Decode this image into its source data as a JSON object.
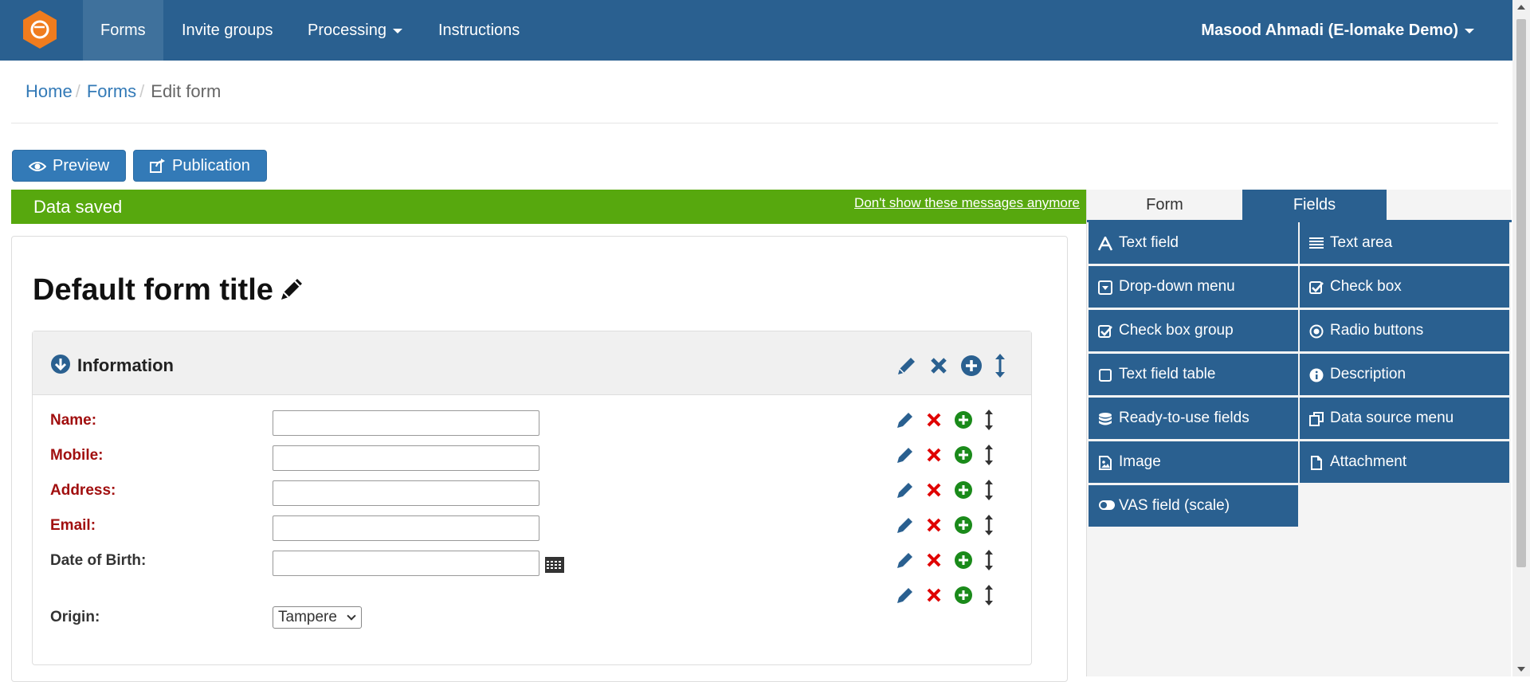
{
  "navbar": {
    "items": [
      {
        "label": "Forms",
        "active": true
      },
      {
        "label": "Invite groups",
        "active": false
      },
      {
        "label": "Processing",
        "active": false,
        "dropdown": true
      },
      {
        "label": "Instructions",
        "active": false
      }
    ],
    "user": "Masood Ahmadi (E-lomake Demo)",
    "logo_color": "#f07c1e"
  },
  "breadcrumb": {
    "home": "Home",
    "forms": "Forms",
    "current": "Edit form"
  },
  "actions": {
    "preview": "Preview",
    "publication": "Publication"
  },
  "alert": {
    "text": "Data saved",
    "dismiss": "Don't show these messages anymore",
    "color": "#57a80e"
  },
  "form": {
    "title": "Default form title",
    "section": {
      "title": "Information",
      "fields": [
        {
          "label": "Name:",
          "required": true,
          "type": "text",
          "value": ""
        },
        {
          "label": "Mobile:",
          "required": true,
          "type": "text",
          "value": ""
        },
        {
          "label": "Address:",
          "required": true,
          "type": "text",
          "value": ""
        },
        {
          "label": "Email:",
          "required": true,
          "type": "text",
          "value": ""
        },
        {
          "label": "Date of Birth:",
          "required": false,
          "type": "date",
          "value": ""
        },
        {
          "label": "Origin:",
          "required": false,
          "type": "select",
          "value": "Tampere"
        }
      ]
    }
  },
  "panel": {
    "tabs": [
      "Form",
      "Fields"
    ],
    "active_tab": "Fields",
    "fields": [
      {
        "label": "Text field",
        "icon": "font-icon"
      },
      {
        "label": "Text area",
        "icon": "lines-icon"
      },
      {
        "label": "Drop-down menu",
        "icon": "dropdown-icon"
      },
      {
        "label": "Check box",
        "icon": "checkbox-icon"
      },
      {
        "label": "Check box group",
        "icon": "checkbox-icon"
      },
      {
        "label": "Radio buttons",
        "icon": "radio-icon"
      },
      {
        "label": "Text field table",
        "icon": "square-icon"
      },
      {
        "label": "Description",
        "icon": "info-icon"
      },
      {
        "label": "Ready-to-use fields",
        "icon": "database-icon"
      },
      {
        "label": "Data source menu",
        "icon": "copy-icon"
      },
      {
        "label": "Image",
        "icon": "image-icon"
      },
      {
        "label": "Attachment",
        "icon": "file-icon"
      },
      {
        "label": "VAS field (scale)",
        "icon": "toggle-icon"
      }
    ]
  },
  "colors": {
    "primary": "#2a6090",
    "button": "#337ab7",
    "required_label": "#a10f0f",
    "delete": "#e00000",
    "add": "#1a8a1a"
  }
}
